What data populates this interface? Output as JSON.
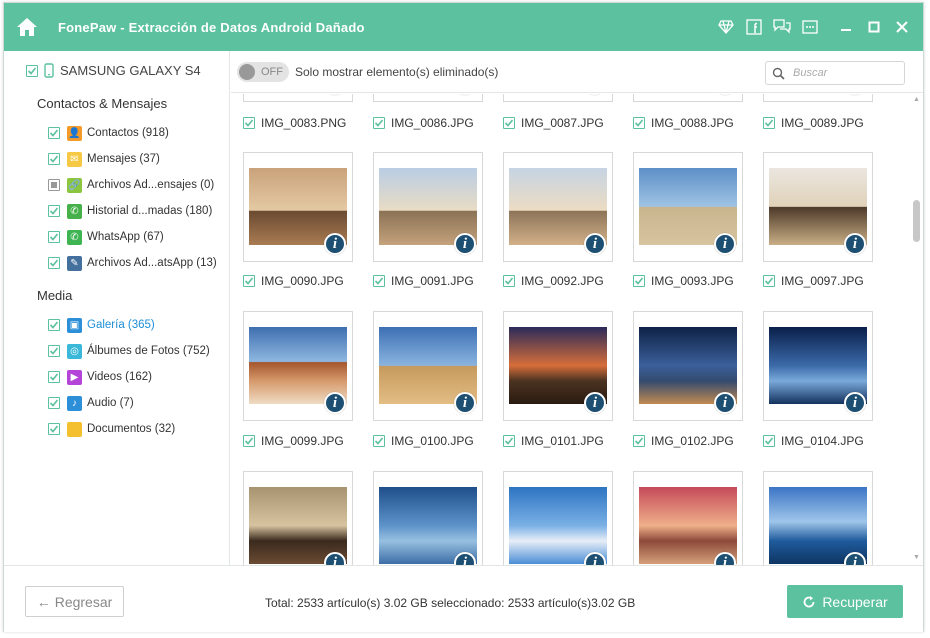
{
  "titlebar": {
    "title": "FonePaw - Extracción de Datos Android Dañado",
    "icons": [
      "home-icon",
      "diamond-icon",
      "facebook-icon",
      "feedback-icon",
      "menu-icon",
      "minimize-icon",
      "maximize-icon",
      "close-icon"
    ]
  },
  "sidebar": {
    "device_name": "SAMSUNG GALAXY S4",
    "section_contacts": "Contactos & Mensajes",
    "section_media": "Media",
    "contacts_items": [
      {
        "label": "Contactos (918)",
        "icon": "contacts-icon",
        "color": "#f39a2b"
      },
      {
        "label": "Mensajes (37)",
        "icon": "messages-icon",
        "color": "#f6c945"
      },
      {
        "label": "Archivos Ad...ensajes (0)",
        "icon": "attachment-icon",
        "color": "#8cc63f"
      },
      {
        "label": "Historial d...madas (180)",
        "icon": "call-history-icon",
        "color": "#46b04a"
      },
      {
        "label": "WhatsApp (67)",
        "icon": "whatsapp-icon",
        "color": "#3fb453"
      },
      {
        "label": "Archivos Ad...atsApp (13)",
        "icon": "whatsapp-attachment-icon",
        "color": "#44709e"
      }
    ],
    "media_items": [
      {
        "label": "Galería (365)",
        "icon": "gallery-icon",
        "color": "#2c8fd8"
      },
      {
        "label": "Álbumes de Fotos (752)",
        "icon": "photo-album-icon",
        "color": "#3ab8d9"
      },
      {
        "label": "Videos (162)",
        "icon": "video-icon",
        "color": "#b545d9"
      },
      {
        "label": "Audio (7)",
        "icon": "audio-icon",
        "color": "#2c8fd8"
      },
      {
        "label": "Documentos (32)",
        "icon": "folder-icon",
        "color": "#f5c02f"
      }
    ]
  },
  "topbar": {
    "toggle_state": "OFF",
    "toggle_label": "Solo mostrar elemento(s) eliminado(s)",
    "search_placeholder": "Buscar"
  },
  "grid": {
    "row0_captions": [
      "IMG_0083.PNG",
      "IMG_0086.JPG",
      "IMG_0087.JPG",
      "IMG_0088.JPG",
      "IMG_0089.JPG"
    ],
    "row1_captions": [
      "IMG_0090.JPG",
      "IMG_0091.JPG",
      "IMG_0092.JPG",
      "IMG_0093.JPG",
      "IMG_0097.JPG"
    ],
    "row2_captions": [
      "IMG_0099.JPG",
      "IMG_0100.JPG",
      "IMG_0101.JPG",
      "IMG_0102.JPG",
      "IMG_0104.JPG"
    ],
    "info_glyph": "i"
  },
  "bottombar": {
    "back_label": "Regresar",
    "totals": "Total: 2533 artículo(s) 3.02 GB seleccionado: 2533 artículo(s)3.02 GB",
    "recover_label": "Recuperar"
  }
}
